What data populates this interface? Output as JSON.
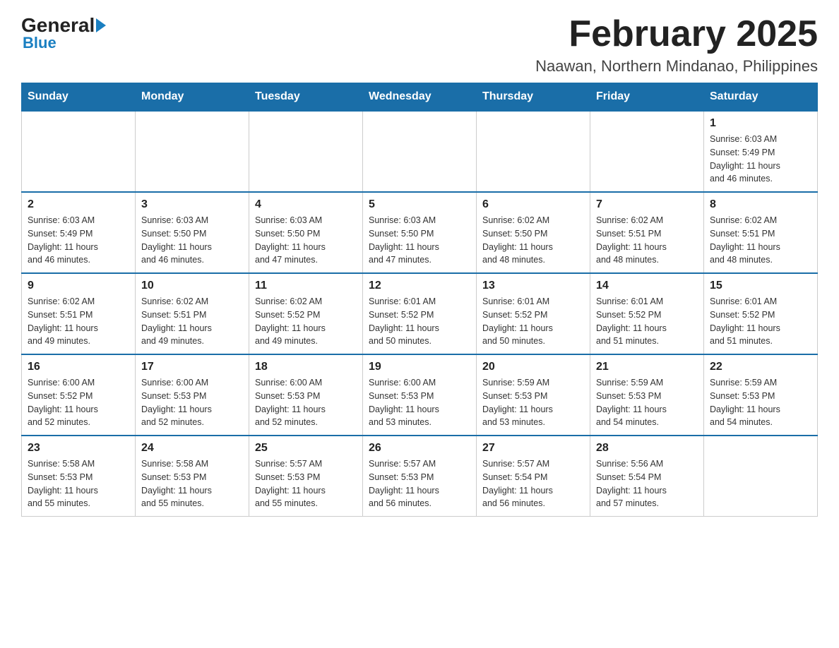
{
  "logo": {
    "text_general": "General",
    "text_blue": "Blue"
  },
  "title": "February 2025",
  "subtitle": "Naawan, Northern Mindanao, Philippines",
  "weekdays": [
    "Sunday",
    "Monday",
    "Tuesday",
    "Wednesday",
    "Thursday",
    "Friday",
    "Saturday"
  ],
  "weeks": [
    [
      {
        "day": "",
        "info": ""
      },
      {
        "day": "",
        "info": ""
      },
      {
        "day": "",
        "info": ""
      },
      {
        "day": "",
        "info": ""
      },
      {
        "day": "",
        "info": ""
      },
      {
        "day": "",
        "info": ""
      },
      {
        "day": "1",
        "info": "Sunrise: 6:03 AM\nSunset: 5:49 PM\nDaylight: 11 hours\nand 46 minutes."
      }
    ],
    [
      {
        "day": "2",
        "info": "Sunrise: 6:03 AM\nSunset: 5:49 PM\nDaylight: 11 hours\nand 46 minutes."
      },
      {
        "day": "3",
        "info": "Sunrise: 6:03 AM\nSunset: 5:50 PM\nDaylight: 11 hours\nand 46 minutes."
      },
      {
        "day": "4",
        "info": "Sunrise: 6:03 AM\nSunset: 5:50 PM\nDaylight: 11 hours\nand 47 minutes."
      },
      {
        "day": "5",
        "info": "Sunrise: 6:03 AM\nSunset: 5:50 PM\nDaylight: 11 hours\nand 47 minutes."
      },
      {
        "day": "6",
        "info": "Sunrise: 6:02 AM\nSunset: 5:50 PM\nDaylight: 11 hours\nand 48 minutes."
      },
      {
        "day": "7",
        "info": "Sunrise: 6:02 AM\nSunset: 5:51 PM\nDaylight: 11 hours\nand 48 minutes."
      },
      {
        "day": "8",
        "info": "Sunrise: 6:02 AM\nSunset: 5:51 PM\nDaylight: 11 hours\nand 48 minutes."
      }
    ],
    [
      {
        "day": "9",
        "info": "Sunrise: 6:02 AM\nSunset: 5:51 PM\nDaylight: 11 hours\nand 49 minutes."
      },
      {
        "day": "10",
        "info": "Sunrise: 6:02 AM\nSunset: 5:51 PM\nDaylight: 11 hours\nand 49 minutes."
      },
      {
        "day": "11",
        "info": "Sunrise: 6:02 AM\nSunset: 5:52 PM\nDaylight: 11 hours\nand 49 minutes."
      },
      {
        "day": "12",
        "info": "Sunrise: 6:01 AM\nSunset: 5:52 PM\nDaylight: 11 hours\nand 50 minutes."
      },
      {
        "day": "13",
        "info": "Sunrise: 6:01 AM\nSunset: 5:52 PM\nDaylight: 11 hours\nand 50 minutes."
      },
      {
        "day": "14",
        "info": "Sunrise: 6:01 AM\nSunset: 5:52 PM\nDaylight: 11 hours\nand 51 minutes."
      },
      {
        "day": "15",
        "info": "Sunrise: 6:01 AM\nSunset: 5:52 PM\nDaylight: 11 hours\nand 51 minutes."
      }
    ],
    [
      {
        "day": "16",
        "info": "Sunrise: 6:00 AM\nSunset: 5:52 PM\nDaylight: 11 hours\nand 52 minutes."
      },
      {
        "day": "17",
        "info": "Sunrise: 6:00 AM\nSunset: 5:53 PM\nDaylight: 11 hours\nand 52 minutes."
      },
      {
        "day": "18",
        "info": "Sunrise: 6:00 AM\nSunset: 5:53 PM\nDaylight: 11 hours\nand 52 minutes."
      },
      {
        "day": "19",
        "info": "Sunrise: 6:00 AM\nSunset: 5:53 PM\nDaylight: 11 hours\nand 53 minutes."
      },
      {
        "day": "20",
        "info": "Sunrise: 5:59 AM\nSunset: 5:53 PM\nDaylight: 11 hours\nand 53 minutes."
      },
      {
        "day": "21",
        "info": "Sunrise: 5:59 AM\nSunset: 5:53 PM\nDaylight: 11 hours\nand 54 minutes."
      },
      {
        "day": "22",
        "info": "Sunrise: 5:59 AM\nSunset: 5:53 PM\nDaylight: 11 hours\nand 54 minutes."
      }
    ],
    [
      {
        "day": "23",
        "info": "Sunrise: 5:58 AM\nSunset: 5:53 PM\nDaylight: 11 hours\nand 55 minutes."
      },
      {
        "day": "24",
        "info": "Sunrise: 5:58 AM\nSunset: 5:53 PM\nDaylight: 11 hours\nand 55 minutes."
      },
      {
        "day": "25",
        "info": "Sunrise: 5:57 AM\nSunset: 5:53 PM\nDaylight: 11 hours\nand 55 minutes."
      },
      {
        "day": "26",
        "info": "Sunrise: 5:57 AM\nSunset: 5:53 PM\nDaylight: 11 hours\nand 56 minutes."
      },
      {
        "day": "27",
        "info": "Sunrise: 5:57 AM\nSunset: 5:54 PM\nDaylight: 11 hours\nand 56 minutes."
      },
      {
        "day": "28",
        "info": "Sunrise: 5:56 AM\nSunset: 5:54 PM\nDaylight: 11 hours\nand 57 minutes."
      },
      {
        "day": "",
        "info": ""
      }
    ]
  ]
}
